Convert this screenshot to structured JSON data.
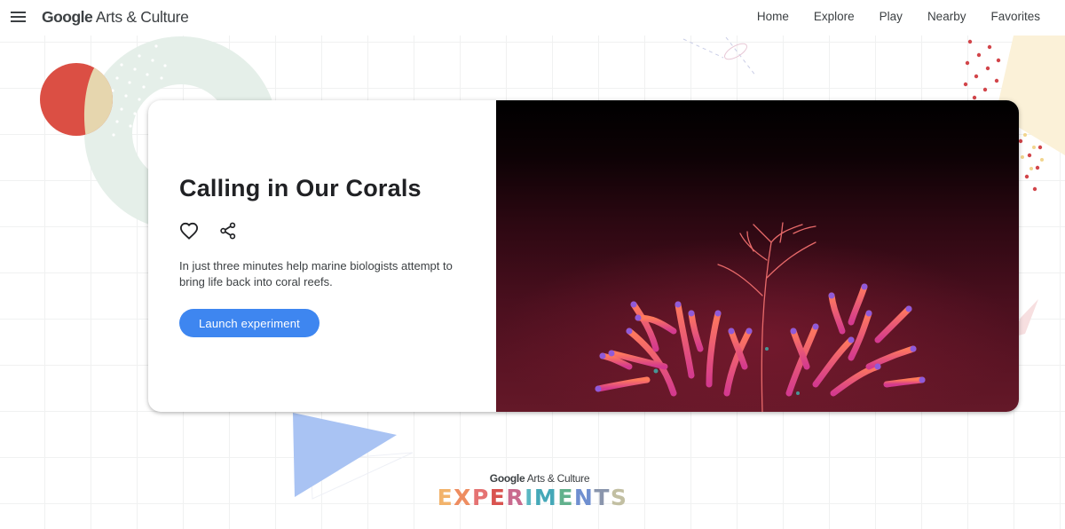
{
  "header": {
    "logo_google": "Google",
    "logo_rest": " Arts & Culture",
    "nav": [
      {
        "label": "Home"
      },
      {
        "label": "Explore"
      },
      {
        "label": "Play"
      },
      {
        "label": "Nearby"
      },
      {
        "label": "Favorites"
      }
    ]
  },
  "experiment": {
    "title": "Calling in Our Corals",
    "description": "In just three minutes help marine biologists attempt to bring life back into coral reefs.",
    "launch_label": "Launch experiment",
    "image_alt": "Colorful pink and orange coral on a dark red background"
  },
  "footer": {
    "brand_google": "Google",
    "brand_rest": " Arts & Culture",
    "experiments_letters": [
      {
        "ch": "E",
        "color": "#f2b36b"
      },
      {
        "ch": "X",
        "color": "#ee8d61"
      },
      {
        "ch": "P",
        "color": "#e57373"
      },
      {
        "ch": "E",
        "color": "#d9534f"
      },
      {
        "ch": "R",
        "color": "#c96a8e"
      },
      {
        "ch": "I",
        "color": "#5bb7c2"
      },
      {
        "ch": "M",
        "color": "#45a8b8"
      },
      {
        "ch": "E",
        "color": "#62b18d"
      },
      {
        "ch": "N",
        "color": "#6f8fd0"
      },
      {
        "ch": "T",
        "color": "#8a95ac"
      },
      {
        "ch": "S",
        "color": "#c2bfa2"
      }
    ]
  },
  "colors": {
    "accent": "#3e86f0",
    "decor_red": "#db4f44",
    "decor_beige": "#e6d6ae",
    "decor_mint": "#e5efe9",
    "decor_blue": "#a9c3f3",
    "decor_yellow": "#fbf1d8"
  }
}
